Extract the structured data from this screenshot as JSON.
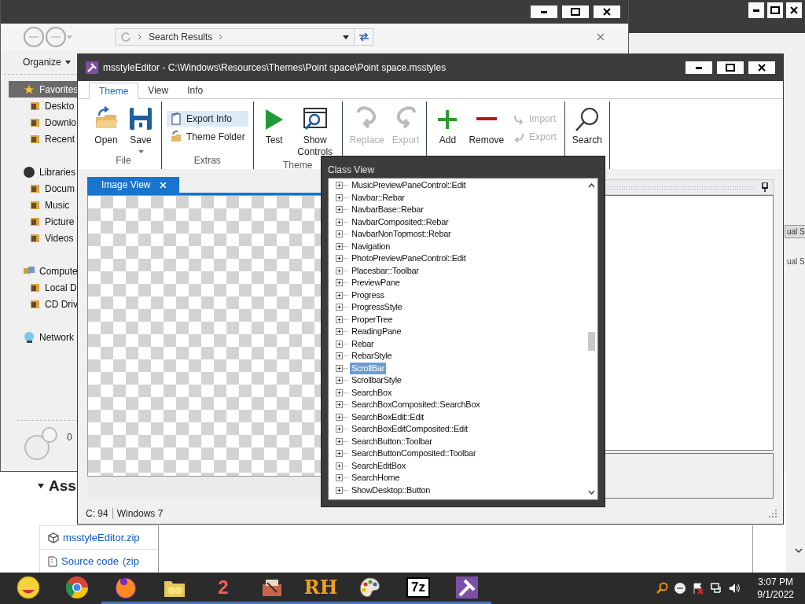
{
  "browser_page": {
    "heading": "Ass",
    "assets": [
      {
        "label": "msstyleEditor.zip"
      },
      {
        "label": "Source code",
        "note": "(zip"
      }
    ],
    "side_texts": [
      "ual S",
      "ual S"
    ]
  },
  "explorer": {
    "address": "Search Results",
    "organize": "Organize",
    "nav": [
      {
        "label": "Favorites",
        "selected": true,
        "children": [
          {
            "label": "Deskto",
            "selected": false
          },
          {
            "label": "Downlo",
            "selected": false
          },
          {
            "label": "Recent",
            "selected": false
          }
        ]
      },
      {
        "label": "Libraries",
        "selected": false,
        "children": [
          {
            "label": "Docum",
            "selected": false
          },
          {
            "label": "Music",
            "selected": false
          },
          {
            "label": "Picture",
            "selected": false
          },
          {
            "label": "Videos",
            "selected": false
          }
        ]
      },
      {
        "label": "Compute",
        "selected": false,
        "children": [
          {
            "label": "Local D",
            "selected": false
          },
          {
            "label": "CD Driv",
            "selected": false
          }
        ]
      },
      {
        "label": "Network",
        "selected": false
      }
    ],
    "details": "0"
  },
  "editor": {
    "title": "msstyleEditor - C:\\Windows\\Resources\\Themes\\Point space\\Point space.msstyles",
    "tabs": [
      {
        "label": "Theme",
        "selected": true
      },
      {
        "label": "View",
        "selected": false
      },
      {
        "label": "Info",
        "selected": false
      }
    ],
    "ribbon_groups": [
      {
        "label": "File",
        "items": [
          {
            "label": "Open",
            "kind": "large",
            "disabled": false
          },
          {
            "label": "Save",
            "kind": "dropdown",
            "disabled": false
          }
        ]
      },
      {
        "label": "Extras",
        "items": [
          {
            "label": "Export Info",
            "kind": "small",
            "disabled": false,
            "highlighted": true
          },
          {
            "label": "Theme Folder",
            "kind": "small",
            "disabled": false,
            "highlighted": false
          }
        ]
      },
      {
        "label": "Theme",
        "items": [
          {
            "label": "Test",
            "kind": "large",
            "disabled": false
          },
          {
            "label": "Show Controls",
            "kind": "large",
            "disabled": false
          }
        ]
      },
      {
        "items": [
          {
            "label": "Replace",
            "kind": "large",
            "disabled": true
          },
          {
            "label": "Export",
            "kind": "large",
            "disabled": true
          }
        ]
      },
      {
        "items": [
          {
            "label": "Add",
            "kind": "large",
            "disabled": false
          },
          {
            "label": "Remove",
            "kind": "large",
            "disabled": false
          },
          {
            "label": "Import",
            "kind": "small",
            "disabled": true,
            "highlighted": false
          },
          {
            "label": "Export",
            "kind": "small",
            "disabled": true,
            "highlighted": false
          }
        ]
      },
      {
        "items": [
          {
            "label": "Search",
            "kind": "large",
            "disabled": false
          }
        ]
      }
    ],
    "document_tab": "Image View",
    "status": [
      "C: 94",
      "Windows 7"
    ]
  },
  "class_view": {
    "title": "Class View",
    "items": [
      {
        "label": "MusicPreviewPaneControl::Edit",
        "selected": false
      },
      {
        "label": "Navbar::Rebar",
        "selected": false
      },
      {
        "label": "NavbarBase::Rebar",
        "selected": false
      },
      {
        "label": "NavbarComposited::Rebar",
        "selected": false
      },
      {
        "label": "NavbarNonTopmost::Rebar",
        "selected": false
      },
      {
        "label": "Navigation",
        "selected": false
      },
      {
        "label": "PhotoPreviewPaneControl::Edit",
        "selected": false
      },
      {
        "label": "Placesbar::Toolbar",
        "selected": false
      },
      {
        "label": "PreviewPane",
        "selected": false
      },
      {
        "label": "Progress",
        "selected": false
      },
      {
        "label": "ProgressStyle",
        "selected": false
      },
      {
        "label": "ProperTree",
        "selected": false
      },
      {
        "label": "ReadingPane",
        "selected": false
      },
      {
        "label": "Rebar",
        "selected": false
      },
      {
        "label": "RebarStyle",
        "selected": false
      },
      {
        "label": "ScrollBar",
        "selected": true
      },
      {
        "label": "ScrollbarStyle",
        "selected": false
      },
      {
        "label": "SearchBox",
        "selected": false
      },
      {
        "label": "SearchBoxComposited::SearchBox",
        "selected": false
      },
      {
        "label": "SearchBoxEdit::Edit",
        "selected": false
      },
      {
        "label": "SearchBoxEditComposited::Edit",
        "selected": false
      },
      {
        "label": "SearchButton::Toolbar",
        "selected": false
      },
      {
        "label": "SearchButtonComposited::Toolbar",
        "selected": false
      },
      {
        "label": "SearchEditBox",
        "selected": false
      },
      {
        "label": "SearchHome",
        "selected": false
      },
      {
        "label": "ShowDesktop::Button",
        "selected": false
      }
    ]
  },
  "taskbar": {
    "apps": [
      {
        "kind": "smiley",
        "running": false
      },
      {
        "kind": "chrome",
        "running": false
      },
      {
        "kind": "firefox",
        "running": true
      },
      {
        "kind": "folder",
        "running": true
      },
      {
        "kind": "text",
        "label": "2",
        "running": true
      },
      {
        "kind": "toolbox",
        "running": true
      },
      {
        "kind": "text",
        "label": "RH",
        "running": true
      },
      {
        "kind": "palette",
        "running": true
      },
      {
        "kind": "boxed",
        "label": "7z",
        "running": true
      },
      {
        "kind": "hammer",
        "running": true
      }
    ],
    "clock": {
      "time": "3:07 PM",
      "date": "9/1/2022"
    }
  }
}
